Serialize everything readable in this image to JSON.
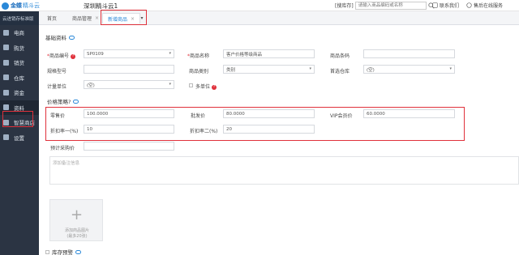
{
  "topbar": {
    "brand": "金蝶",
    "brand_sub": "精斗云",
    "store_name": "深圳精斗云1",
    "search_scope": "[搜库存]",
    "search_placeholder": "请输入商品编码或名称",
    "contact_label": "联系我们",
    "service_label": "售后在线服务"
  },
  "sidebar": {
    "header": "云进销存标准版",
    "items": [
      {
        "label": "电商",
        "icon": "ecommerce-icon"
      },
      {
        "label": "购货",
        "icon": "purchase-icon"
      },
      {
        "label": "销货",
        "icon": "sales-icon"
      },
      {
        "label": "仓库",
        "icon": "warehouse-icon"
      },
      {
        "label": "资金",
        "icon": "funds-icon"
      },
      {
        "label": "资料",
        "icon": "data-icon"
      },
      {
        "label": "智慧商店",
        "icon": "smart-store-icon"
      },
      {
        "label": "设置",
        "icon": "settings-icon"
      }
    ]
  },
  "tabs": [
    {
      "label": "首页"
    },
    {
      "label": "商品管理"
    },
    {
      "label": "新增商品"
    }
  ],
  "content": {
    "basic_section": "基础资料",
    "code_label": "商品编号",
    "code_value": "SP0109",
    "name_label": "商品名称",
    "name_value": "客户价格等级商品",
    "barcode_label": "商品条码",
    "spec_label": "规格型号",
    "category_label": "商品类别",
    "category_value": "类别",
    "warehouse_label": "首选仓库",
    "warehouse_value": "(空)",
    "unit_label": "计量单位",
    "unit_value": "(空)",
    "multi_unit_label": "多单位",
    "price_section": "价格策略?",
    "retail_label": "零售价",
    "retail_value": "100.0000",
    "wholesale_label": "批发价",
    "wholesale_value": "80.0000",
    "vip_label": "VIP会员价",
    "vip_value": "60.0000",
    "discount1_label": "折扣率一(%)",
    "discount1_value": "10",
    "discount2_label": "折扣率二(%)",
    "discount2_value": "20",
    "est_purchase_label": "预计采购价",
    "remark_placeholder": "添加备注信息",
    "upload_line1": "添加商品图片",
    "upload_line2": "(最多20张)",
    "stock_alert_label": "库存预警"
  }
}
